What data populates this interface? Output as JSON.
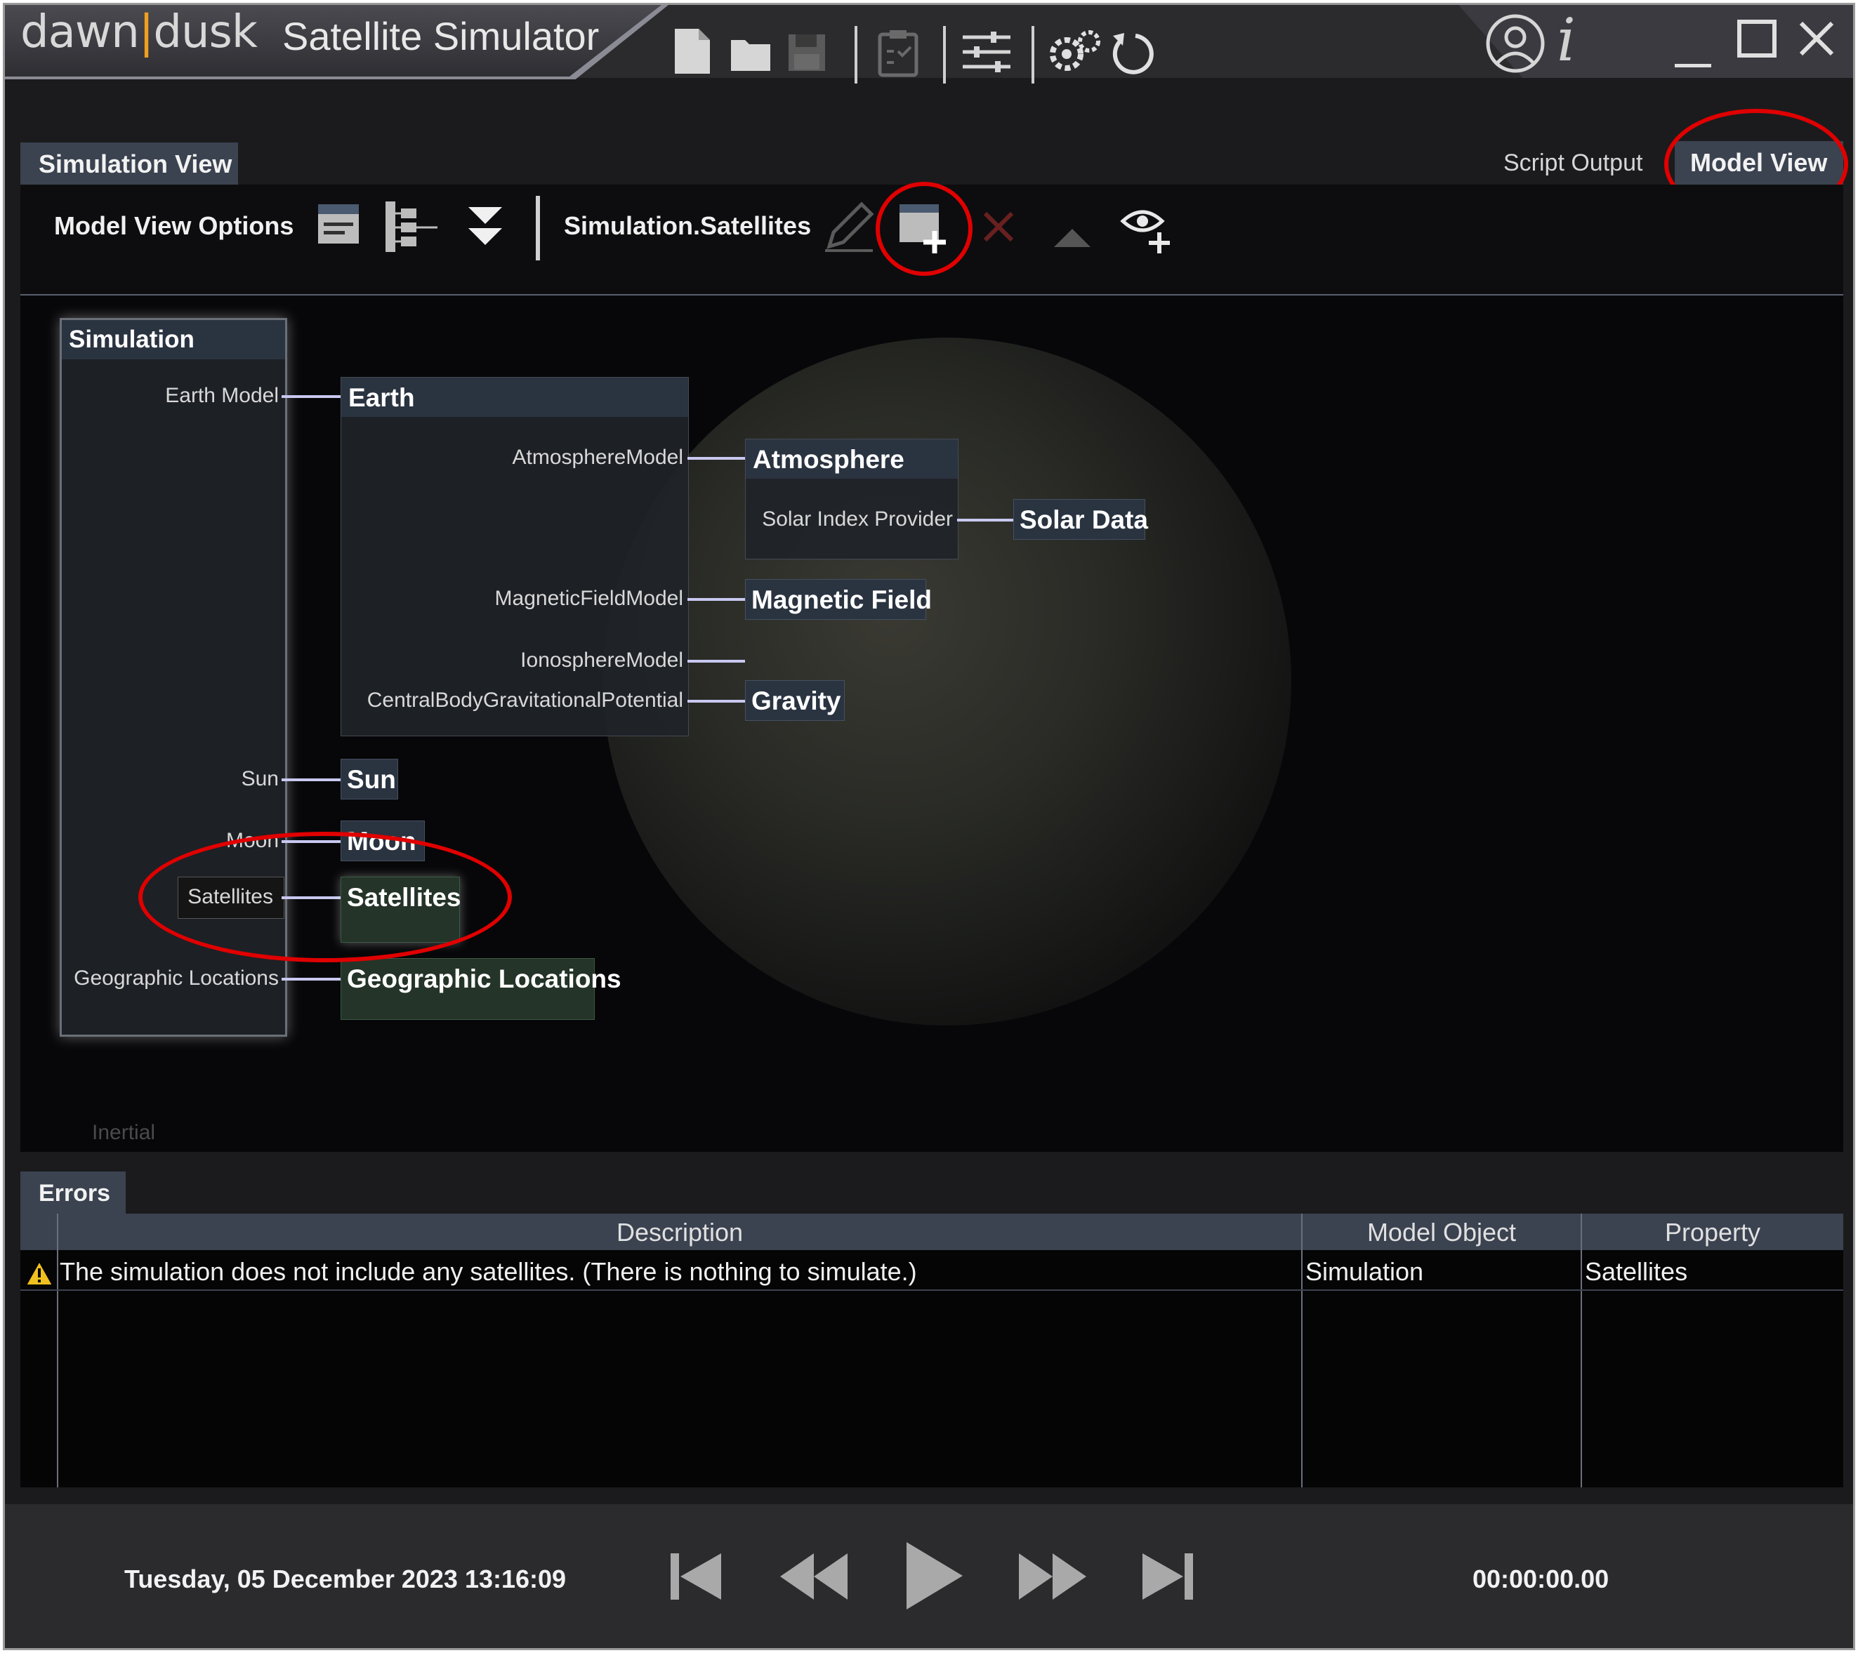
{
  "window": {
    "logo_left": "dawn",
    "logo_mark": "|",
    "logo_right": "dusk",
    "title": "Satellite Simulator",
    "icons": [
      "new-file-icon",
      "open-folder-icon",
      "save-icon",
      "clipboard-icon",
      "sliders-icon",
      "settings-icon",
      "reset-icon",
      "user-icon",
      "info-icon",
      "minimize-icon",
      "maximize-icon",
      "close-icon"
    ]
  },
  "header": {
    "simulation_tab": "Simulation View",
    "script_output": "Script Output",
    "model_view_tab": "Model View"
  },
  "toolbar": {
    "options_label": "Model View Options",
    "path": "Simulation.Satellites"
  },
  "tree": {
    "root": "Simulation",
    "root_props": {
      "earth": "Earth Model",
      "sun": "Sun",
      "moon": "Moon",
      "satellites": "Satellites",
      "geo": "Geographic Locations"
    },
    "earth": {
      "title": "Earth",
      "props": {
        "atmosphere": "AtmosphereModel",
        "magnetic": "MagneticFieldModel",
        "ionosphere": "IonosphereModel",
        "gravity": "CentralBodyGravitationalPotential"
      }
    },
    "atmosphere": {
      "title": "Atmosphere",
      "prop": "Solar Index Provider"
    },
    "solar_data": "Solar Data",
    "magnetic_field": "Magnetic Field",
    "gravity": "Gravity",
    "sun": "Sun",
    "moon": "Moon",
    "satellites": "Satellites",
    "geo": "Geographic Locations",
    "frame_label": "Inertial"
  },
  "errors": {
    "tab": "Errors",
    "columns": [
      "Description",
      "Model Object",
      "Property"
    ],
    "rows": [
      {
        "icon": "warning-icon",
        "description": "The simulation does not include any satellites. (There is nothing to simulate.)",
        "object": "Simulation",
        "property": "Satellites"
      }
    ]
  },
  "transport": {
    "date": "Tuesday, 05 December 2023 13:16:09",
    "elapsed": "00:00:00.00"
  },
  "colors": {
    "annotation": "#e00000",
    "tab_bg": "#3b4250",
    "connector": "#c8c8f0"
  }
}
